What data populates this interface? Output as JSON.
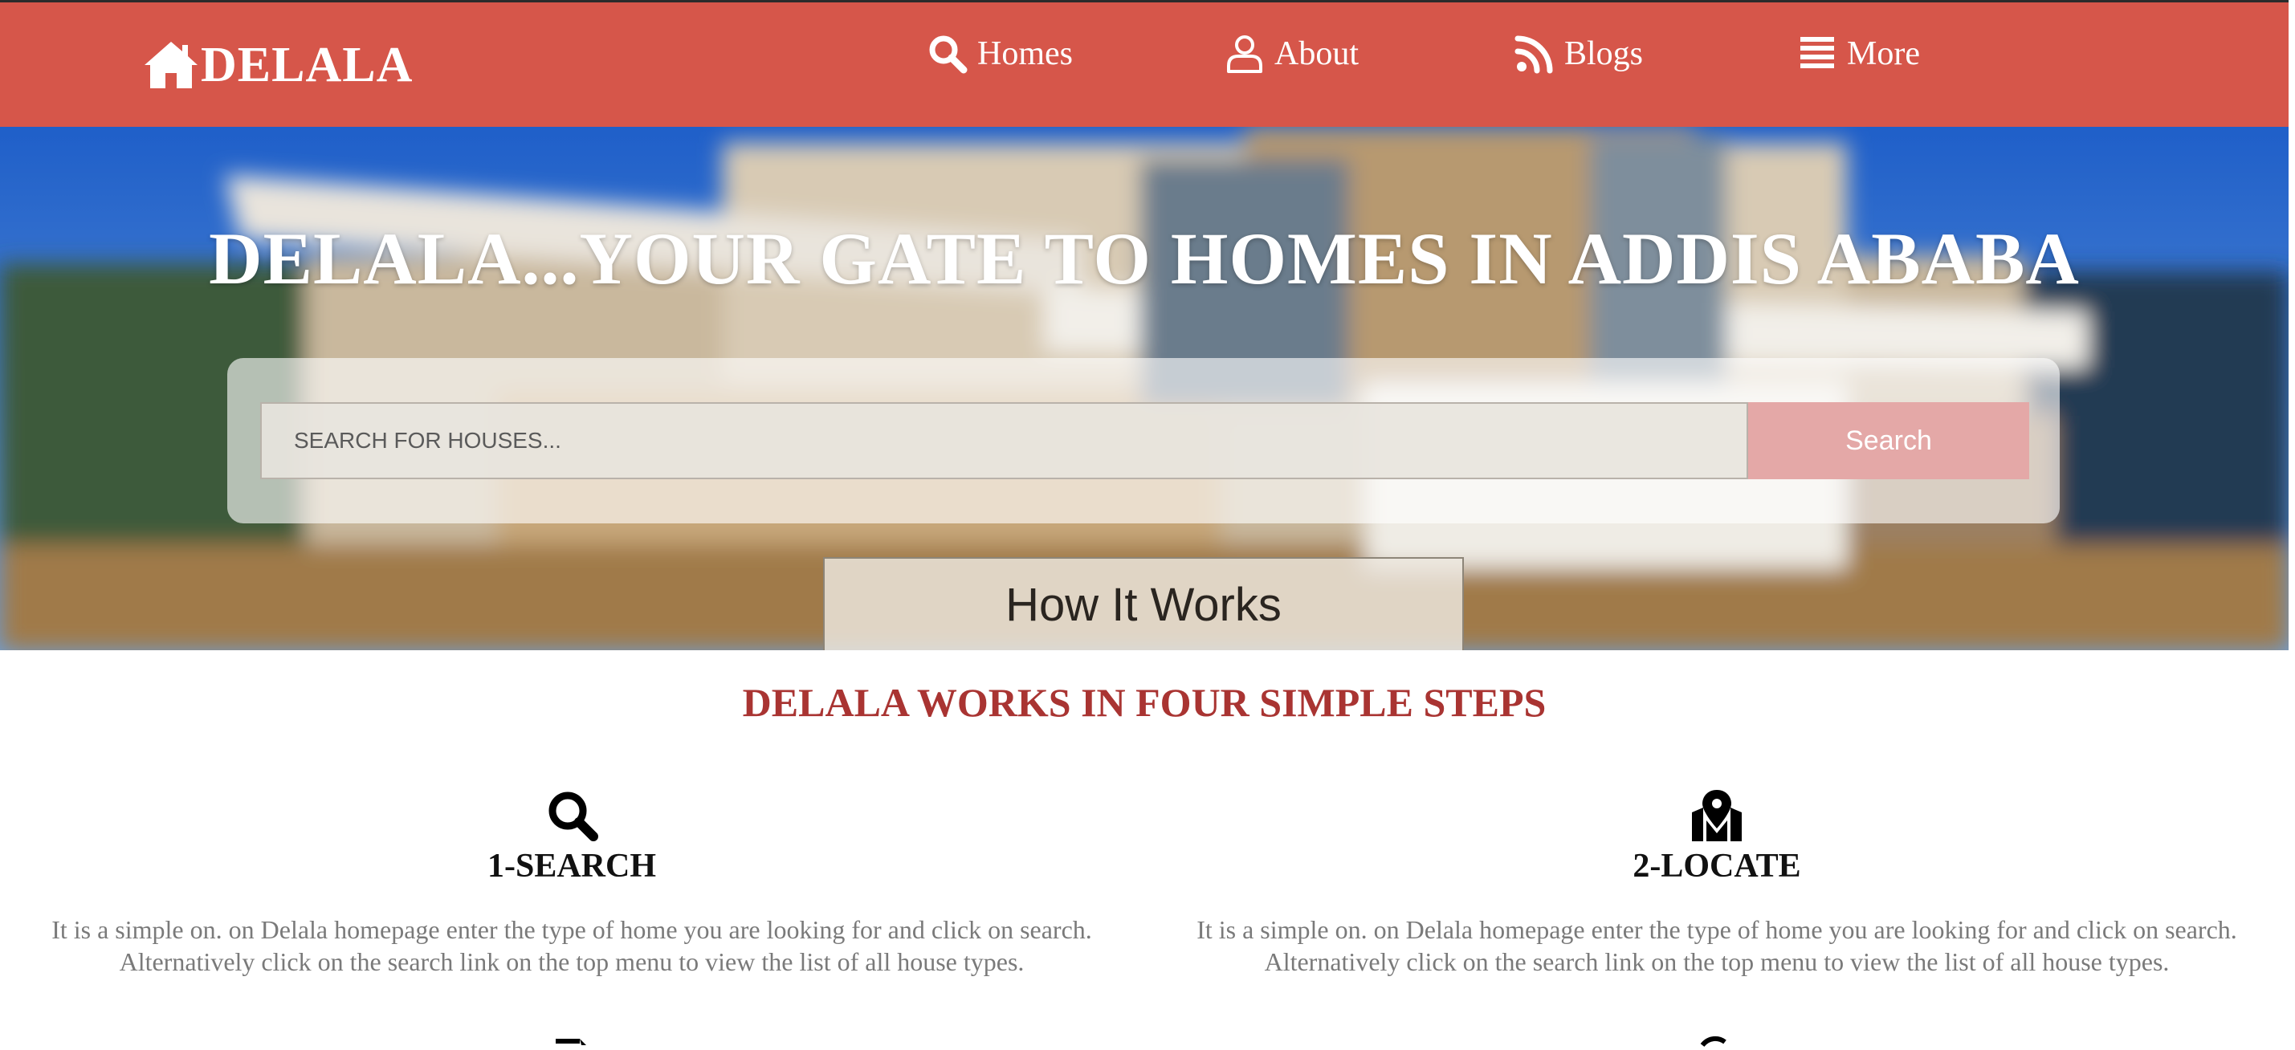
{
  "brand": {
    "name": "DELALA",
    "icon": "home-icon"
  },
  "nav": {
    "items": [
      {
        "label": "Homes",
        "icon": "search-icon"
      },
      {
        "label": "About",
        "icon": "user-icon"
      },
      {
        "label": "Blogs",
        "icon": "rss-icon"
      },
      {
        "label": "More",
        "icon": "menu-icon"
      }
    ]
  },
  "hero": {
    "title": "DELALA...YOUR GATE TO HOMES IN ADDIS ABABA",
    "search_placeholder": "SEARCH FOR HOUSES...",
    "search_button": "Search",
    "how_button": "How It Works"
  },
  "steps": {
    "heading": "DELALA WORKS IN FOUR SIMPLE STEPS",
    "items": [
      {
        "title": "1-SEARCH",
        "icon": "search-icon",
        "text": "It is a simple on. on Delala homepage enter the type of home you are looking for and click on search. Alternatively click on the search link on the top menu to view the list of all house types."
      },
      {
        "title": "2-LOCATE",
        "icon": "map-marker-icon",
        "text": "It is a simple on. on Delala homepage enter the type of home you are looking for and click on search. Alternatively click on the search link on the top menu to view the list of all house types."
      }
    ]
  },
  "colors": {
    "navbar": "#d6564a",
    "heading_accent": "#a93432",
    "search_button": "#e4a8a7",
    "body_text": "#7a7a7a"
  }
}
